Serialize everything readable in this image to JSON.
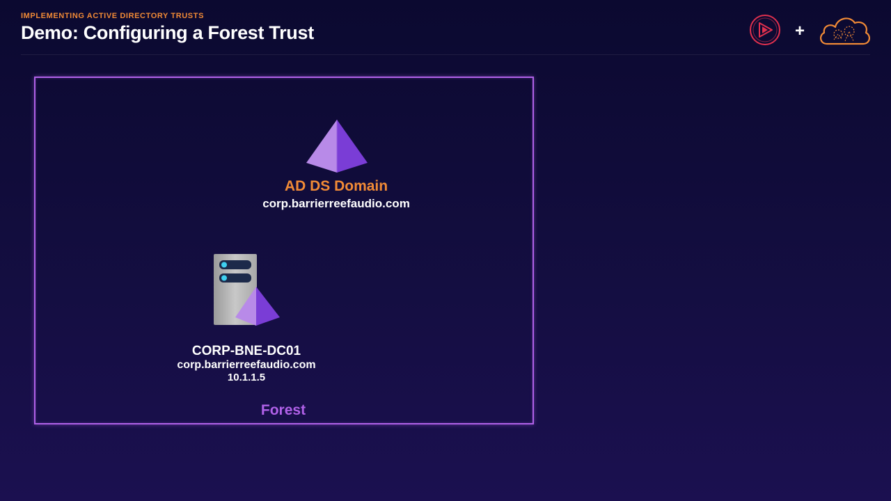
{
  "header": {
    "section_label": "IMPLEMENTING ACTIVE DIRECTORY TRUSTS",
    "title": "Demo: Configuring a Forest Trust"
  },
  "brand": {
    "play_icon": "play-logo-icon",
    "plus": "+",
    "cloud_icon": "cloud-logo-icon"
  },
  "domain": {
    "icon": "pyramid-icon",
    "title": "AD DS Domain",
    "fqdn": "corp.barrierreefaudio.com"
  },
  "domain_controller": {
    "icon": "server-icon",
    "name": "CORP-BNE-DC01",
    "fqdn": "corp.barrierreefaudio.com",
    "ip": "10.1.1.5"
  },
  "forest": {
    "label": "Forest"
  },
  "colors": {
    "accent_orange": "#f28b36",
    "forest_purple": "#b061e8",
    "logo_red": "#e0304e",
    "background_top": "#0b0930",
    "background_bottom": "#1b1050"
  }
}
